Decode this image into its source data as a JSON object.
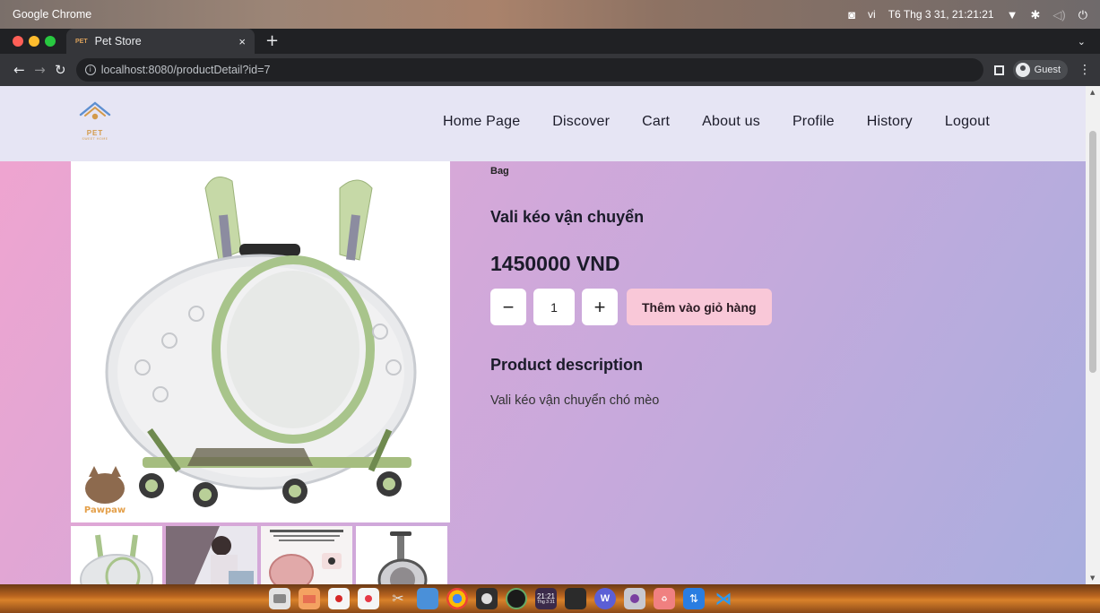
{
  "os_bar": {
    "app_name": "Google Chrome",
    "lang": "vi",
    "datetime": "T6 Thg 3 31, 21:21:21",
    "icons": [
      "camera-icon",
      "wifi-icon",
      "bluetooth-icon",
      "volume-icon",
      "power-icon"
    ]
  },
  "browser": {
    "tab_title": "Pet Store",
    "tab_favicon": "PET",
    "tab_close": "×",
    "new_tab": "+",
    "url": "localhost:8080/productDetail?id=7",
    "profile_label": "Guest"
  },
  "site": {
    "logo_text": "PET",
    "logo_sub": "SWEET HOME",
    "nav": [
      "Home Page",
      "Discover",
      "Cart",
      "About us",
      "Profile",
      "History",
      "Logout"
    ]
  },
  "product": {
    "category": "Bag",
    "name": "Vali kéo vận chuyển",
    "price": "1450000 VND",
    "quantity": "1",
    "decrease_label": "−",
    "increase_label": "+",
    "add_to_cart_label": "Thêm vào giỏ hàng",
    "description_title": "Product description",
    "description": "Vali kéo vận chuyển chó mèo",
    "watermark": "Pawpaw"
  },
  "dock": {
    "clock_time": "21:21",
    "clock_date": "Thg 3 31",
    "apps": [
      "files-icon",
      "slides-icon",
      "document-icon",
      "pdf-icon",
      "scissors-icon",
      "window-icon",
      "chrome-icon",
      "photos-icon",
      "obs-icon",
      "clock-icon",
      "terminal-icon",
      "wps-icon",
      "camera-app-icon",
      "recycle-icon",
      "transfer-icon",
      "vscode-icon"
    ]
  },
  "colors": {
    "header_bg": "#e6e5f4",
    "add_cart_bg": "#f9c8d8",
    "bg_gradient_start": "#f1a4cf",
    "bg_gradient_end": "#a9aede"
  }
}
